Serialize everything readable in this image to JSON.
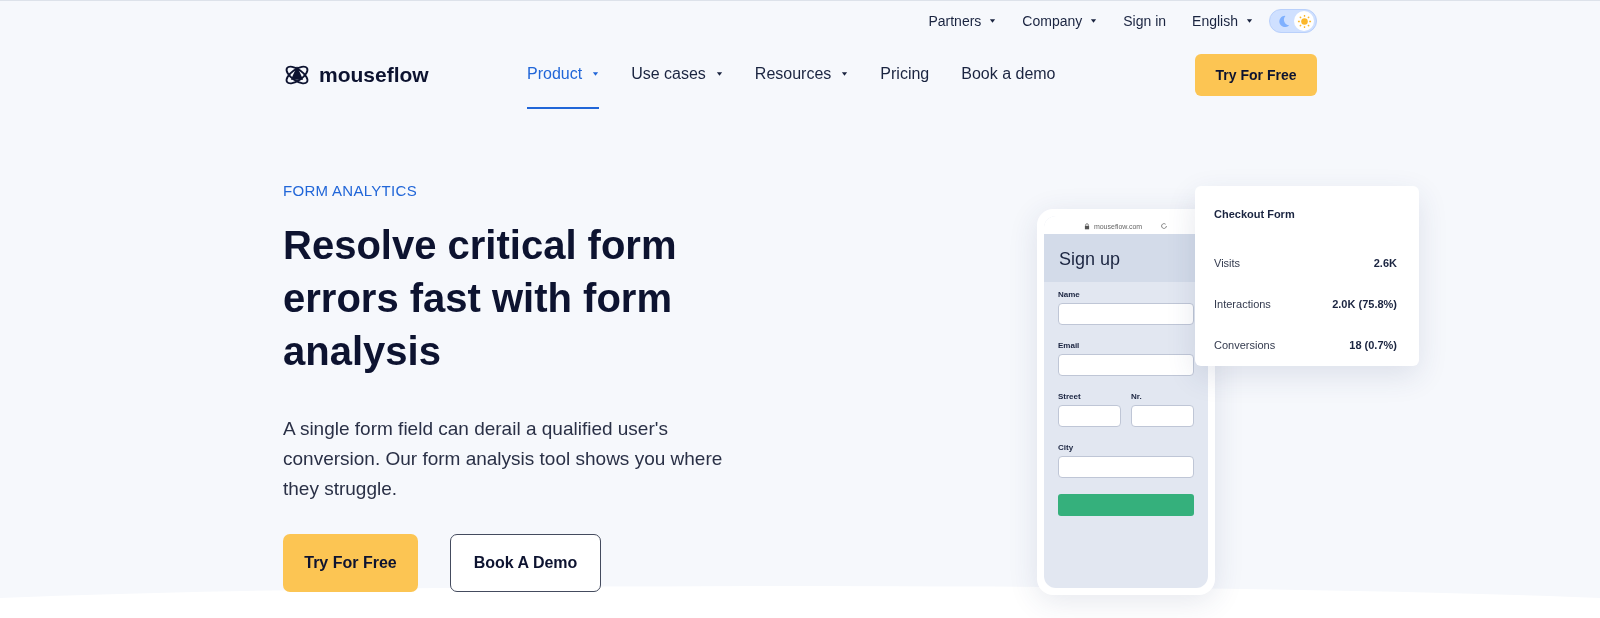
{
  "top_bar": {
    "links": [
      {
        "label": "Partners",
        "dropdown": true
      },
      {
        "label": "Company",
        "dropdown": true
      },
      {
        "label": "Sign in",
        "dropdown": false
      },
      {
        "label": "English",
        "dropdown": true
      }
    ],
    "theme_toggle": {
      "dark": false
    }
  },
  "nav": {
    "logo": "mouseflow",
    "items": [
      {
        "label": "Product",
        "dropdown": true,
        "selected": true
      },
      {
        "label": "Use cases",
        "dropdown": true,
        "selected": false
      },
      {
        "label": "Resources",
        "dropdown": true,
        "selected": false
      },
      {
        "label": "Pricing",
        "dropdown": false,
        "selected": false
      },
      {
        "label": "Book a demo",
        "dropdown": false,
        "selected": false
      }
    ],
    "cta": "Try For Free"
  },
  "hero": {
    "eyebrow": "FORM ANALYTICS",
    "heading": "Resolve critical form errors fast with form analysis",
    "text": "A single form field can derail a qualified user's conversion. Our form analysis tool shows you where they struggle.",
    "buttons": [
      {
        "label": "Try For Free",
        "kind": "primary"
      },
      {
        "label": "Book A Demo",
        "kind": "secondary"
      }
    ]
  },
  "phone": {
    "url": "mouseflow.com",
    "title": "Sign up",
    "fields": [
      {
        "label": "Name",
        "kind": "full"
      },
      {
        "label": "Email",
        "kind": "full"
      },
      {
        "label": "Street",
        "kind": "half"
      },
      {
        "label": "Nr.",
        "kind": "half"
      },
      {
        "label": "City",
        "kind": "full"
      }
    ]
  },
  "stats_card": {
    "title": "Checkout Form",
    "rows": [
      {
        "label": "Visits",
        "value": "2.6K"
      },
      {
        "label": "Interactions",
        "value": "2.0K (75.8%)"
      },
      {
        "label": "Conversions",
        "value": "18 (0.7%)"
      }
    ]
  }
}
